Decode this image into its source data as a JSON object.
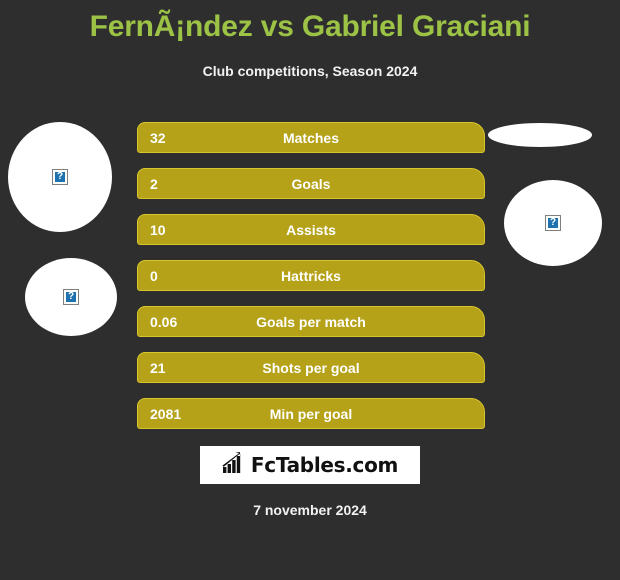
{
  "header": {
    "title": "FernÃ¡ndez vs Gabriel Graciani",
    "subtitle": "Club competitions, Season 2024",
    "title_color": "#9cc246"
  },
  "photos": [
    {
      "name": "player-photo-left-top",
      "alt_glyph": "?"
    },
    {
      "name": "player-photo-left-bottom",
      "alt_glyph": "?"
    },
    {
      "name": "player-photo-right-top",
      "alt_glyph": ""
    },
    {
      "name": "player-photo-right-bottom",
      "alt_glyph": "?"
    }
  ],
  "chart_data": {
    "type": "bar",
    "title": "FernÃ¡ndez vs Gabriel Graciani",
    "subtitle": "Club competitions, Season 2024",
    "categories": [
      "Matches",
      "Goals",
      "Assists",
      "Hattricks",
      "Goals per match",
      "Shots per goal",
      "Min per goal"
    ],
    "values": [
      32,
      2,
      10,
      0,
      0.06,
      21,
      2081
    ],
    "value_labels": [
      "32",
      "2",
      "10",
      "0",
      "0.06",
      "21",
      "2081"
    ],
    "xlabel": "",
    "ylabel": "",
    "grid": false,
    "legend": "none",
    "bar_color": "#b5a219",
    "bar_border_color": "#d8c52c",
    "text_color": "#ffffff",
    "background": "#2e2e2e"
  },
  "stats": [
    {
      "value": "32",
      "label": "Matches"
    },
    {
      "value": "2",
      "label": "Goals"
    },
    {
      "value": "10",
      "label": "Assists"
    },
    {
      "value": "0",
      "label": "Hattricks"
    },
    {
      "value": "0.06",
      "label": "Goals per match"
    },
    {
      "value": "21",
      "label": "Shots per goal"
    },
    {
      "value": "2081",
      "label": "Min per goal"
    }
  ],
  "footer": {
    "logo_text": "FcTables.com",
    "logo_icon": "bar-chart-icon",
    "date": "7 november 2024"
  }
}
